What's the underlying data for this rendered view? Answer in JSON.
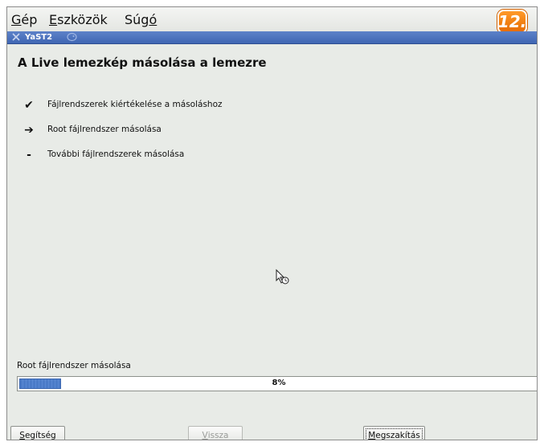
{
  "menubar": {
    "items": [
      {
        "label": "Gép",
        "mnemonic": "G"
      },
      {
        "label": "Eszközök",
        "mnemonic": "E"
      },
      {
        "label": "Súgó",
        "mnemonic": "ó"
      }
    ],
    "badge": "12."
  },
  "window": {
    "title": "YaST2"
  },
  "page": {
    "heading": "A Live lemezkép másolása a lemezre",
    "steps": [
      {
        "status": "done",
        "symbol": "✔",
        "label": "Fájlrendszerek kiértékelése a másoláshoz"
      },
      {
        "status": "current",
        "symbol": "➔",
        "label": "Root fájlrendszer másolása"
      },
      {
        "status": "pending",
        "symbol": "-",
        "label": "További fájlrendszerek másolása"
      }
    ]
  },
  "progress": {
    "label": "Root fájlrendszer másolása",
    "percent": 8,
    "text": "8%"
  },
  "buttons": {
    "help": "Segítség",
    "back": "Vissza",
    "abort": "Megszakítás"
  },
  "colors": {
    "titlebar": "#4a70bd",
    "progress_fill": "#4b7bc8",
    "badge": "#f07a00"
  }
}
